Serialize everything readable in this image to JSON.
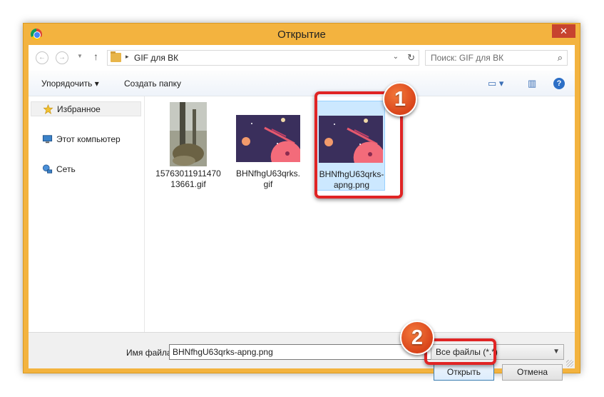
{
  "window": {
    "title": "Открытие",
    "close_glyph": "✕"
  },
  "nav_buttons": {
    "back": "←",
    "forward": "→",
    "up": "↑"
  },
  "address": {
    "crumb": "GIF для ВК",
    "separator": "▸",
    "dropdown_glyph": "⌄",
    "refresh_glyph": "↻"
  },
  "search": {
    "placeholder": "Поиск: GIF для ВК",
    "icon": "search-icon"
  },
  "toolbar": {
    "organize": "Упорядочить ▾",
    "new_folder": "Создать папку",
    "view_glyph": "▭ ▾",
    "pane_glyph": "▥",
    "help_glyph": "?"
  },
  "sidebar": {
    "items": [
      {
        "label": "Избранное",
        "icon": "star-icon",
        "selected": true
      },
      {
        "label": "Этот компьютер",
        "icon": "computer-icon",
        "selected": false
      },
      {
        "label": "Сеть",
        "icon": "network-icon",
        "selected": false
      }
    ]
  },
  "files": [
    {
      "name": "1576301191147013661.gif",
      "kind": "photo",
      "selected": false
    },
    {
      "name": "BHNfhgU63qrks.gif",
      "kind": "space-art",
      "selected": false
    },
    {
      "name": "BHNfhgU63qrks-apng.png",
      "kind": "space-art",
      "selected": true
    }
  ],
  "bottom": {
    "filename_label": "Имя файла:",
    "filename_value": "BHNfhgU63qrks-apng.png",
    "filetype": "Все файлы (*.*)",
    "open_button": "Открыть",
    "cancel_button": "Отмена"
  },
  "annotations": [
    {
      "number": "1",
      "color": "#e02424"
    },
    {
      "number": "2",
      "color": "#e02424"
    }
  ],
  "colors": {
    "window_frame": "#f3b33f",
    "selection": "#cce8ff",
    "highlight": "#e02424"
  }
}
